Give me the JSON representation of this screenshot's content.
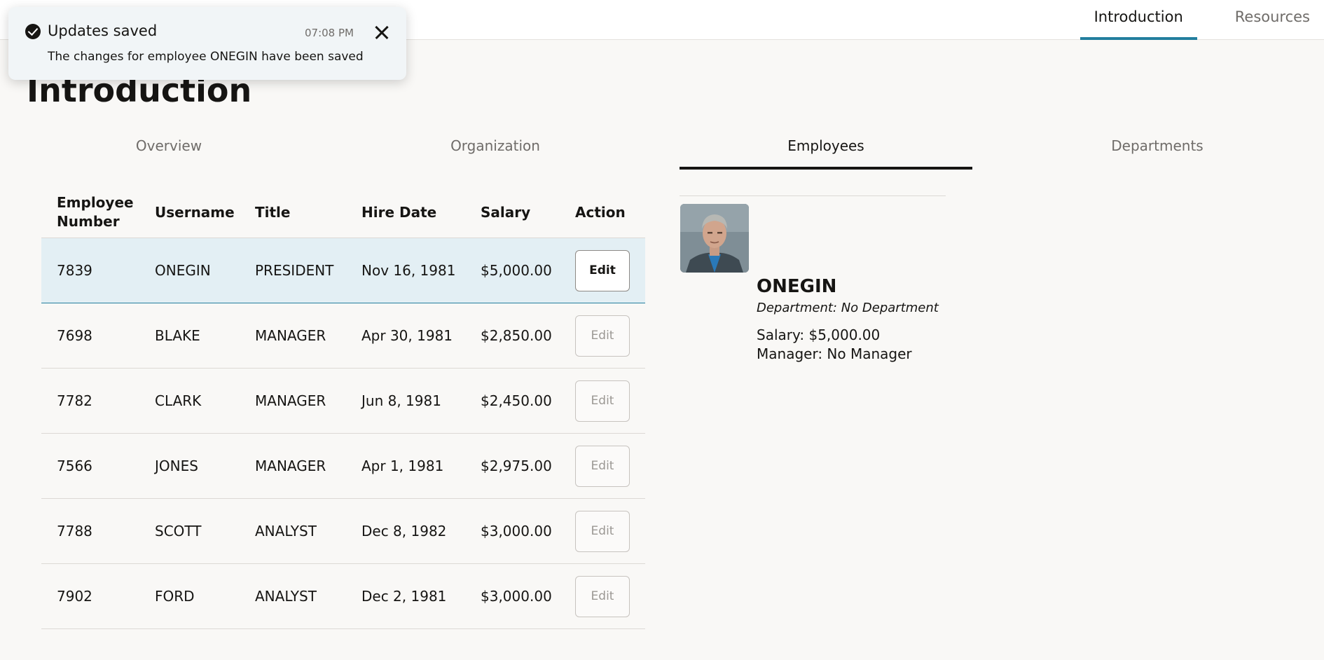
{
  "topnav": {
    "items": [
      {
        "label": "Introduction",
        "active": true
      },
      {
        "label": "Resources",
        "active": false
      }
    ],
    "accent_color": "#227e9e"
  },
  "toast": {
    "icon": "check-circle-icon",
    "title": "Updates saved",
    "time": "07:08 PM",
    "message": "The changes for employee ONEGIN have been saved"
  },
  "page": {
    "title": "Introduction"
  },
  "tabs": [
    {
      "label": "Overview",
      "active": false
    },
    {
      "label": "Organization",
      "active": false
    },
    {
      "label": "Employees",
      "active": true
    },
    {
      "label": "Departments",
      "active": false
    }
  ],
  "table": {
    "columns": [
      "Employee Number",
      "Username",
      "Title",
      "Hire Date",
      "Salary",
      "Action"
    ],
    "rows": [
      {
        "number": "7839",
        "username": "ONEGIN",
        "title": "PRESIDENT",
        "hire_date": "Nov 16, 1981",
        "salary": "$5,000.00",
        "action": "Edit",
        "selected": true
      },
      {
        "number": "7698",
        "username": "BLAKE",
        "title": "MANAGER",
        "hire_date": "Apr 30, 1981",
        "salary": "$2,850.00",
        "action": "Edit",
        "selected": false
      },
      {
        "number": "7782",
        "username": "CLARK",
        "title": "MANAGER",
        "hire_date": "Jun 8, 1981",
        "salary": "$2,450.00",
        "action": "Edit",
        "selected": false
      },
      {
        "number": "7566",
        "username": "JONES",
        "title": "MANAGER",
        "hire_date": "Apr 1, 1981",
        "salary": "$2,975.00",
        "action": "Edit",
        "selected": false
      },
      {
        "number": "7788",
        "username": "SCOTT",
        "title": "ANALYST",
        "hire_date": "Dec 8, 1982",
        "salary": "$3,000.00",
        "action": "Edit",
        "selected": false
      },
      {
        "number": "7902",
        "username": "FORD",
        "title": "ANALYST",
        "hire_date": "Dec 2, 1981",
        "salary": "$3,000.00",
        "action": "Edit",
        "selected": false
      }
    ]
  },
  "detail": {
    "name": "ONEGIN",
    "department": "Department: No Department",
    "salary": "Salary: $5,000.00",
    "manager": "Manager: No Manager"
  },
  "colors": {
    "selected_row": "#e3eff4",
    "background": "#f9f8f6"
  }
}
